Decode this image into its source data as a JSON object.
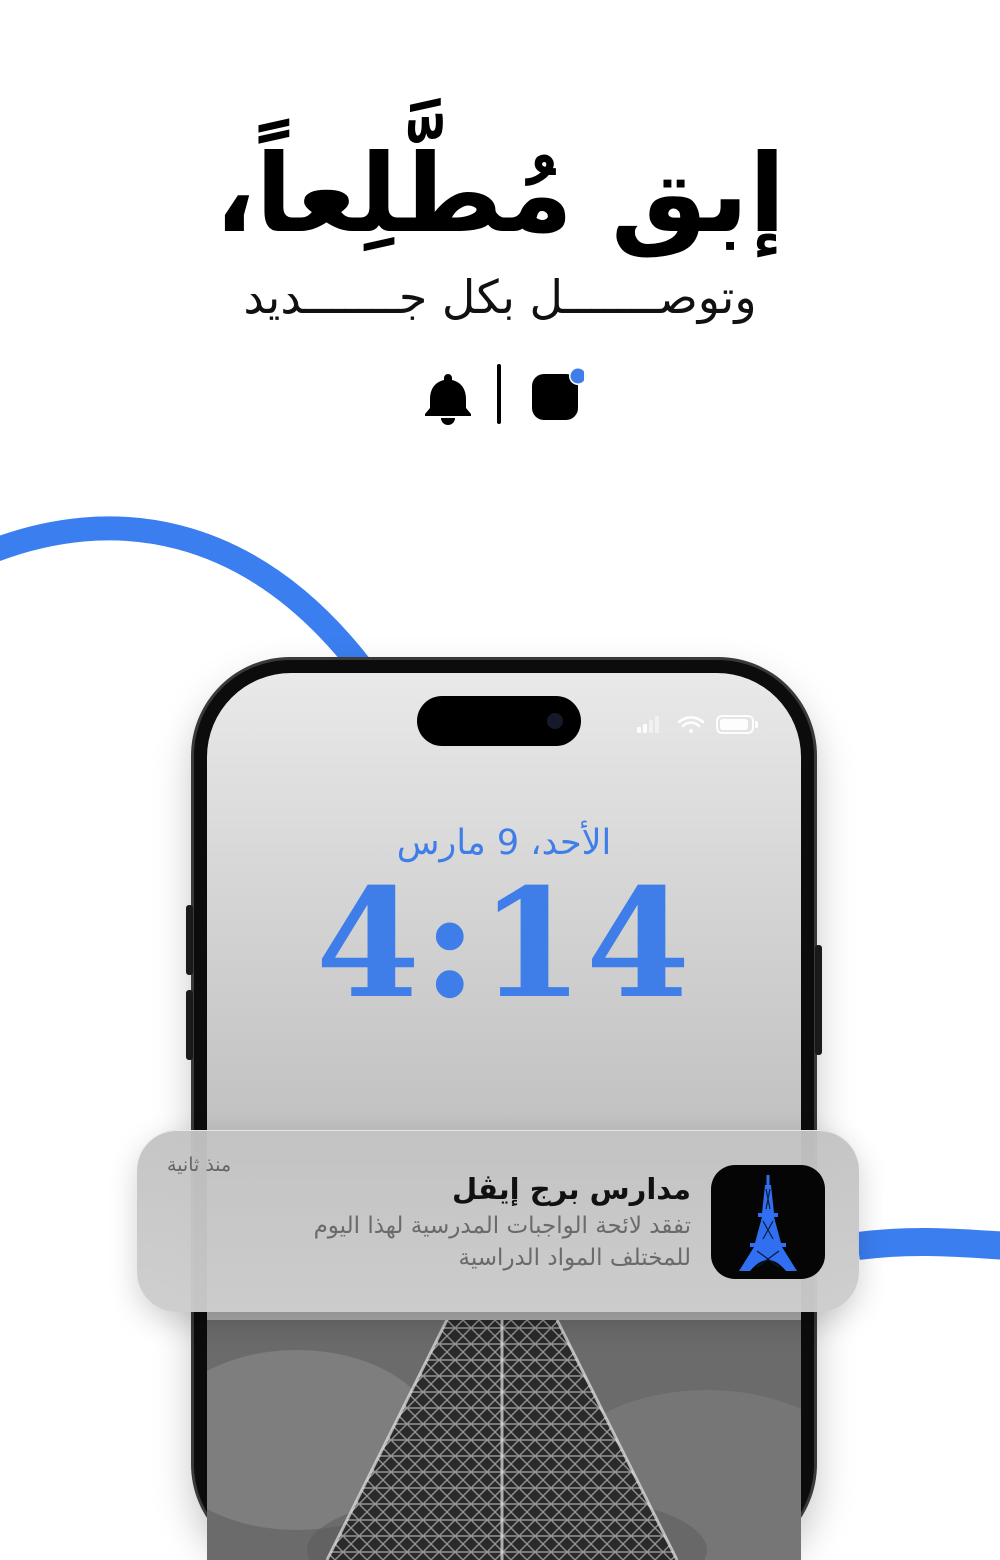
{
  "headline": "إبق مُطَّلِعاً،",
  "subline": "وتوصـــــــل بكل جـــــــديد",
  "icons": {
    "left": "bell-icon",
    "right": "app-notification-icon"
  },
  "lock_screen": {
    "date": "الأحد، 9 مارس",
    "time": "4:14"
  },
  "notification": {
    "app_name": "مدارس برج إيڤل",
    "time_ago": "منذ ثانية",
    "body": "تفقد لائحة الواجبات المدرسية لهذا اليوم للمختلف المواد الدراسية",
    "app_icon": "eiffel-tower-icon"
  },
  "colors": {
    "accent": "#3f7ee8",
    "curve": "#3b7ef0",
    "headline": "#000000",
    "notification_bg": "#c8c8c8"
  }
}
